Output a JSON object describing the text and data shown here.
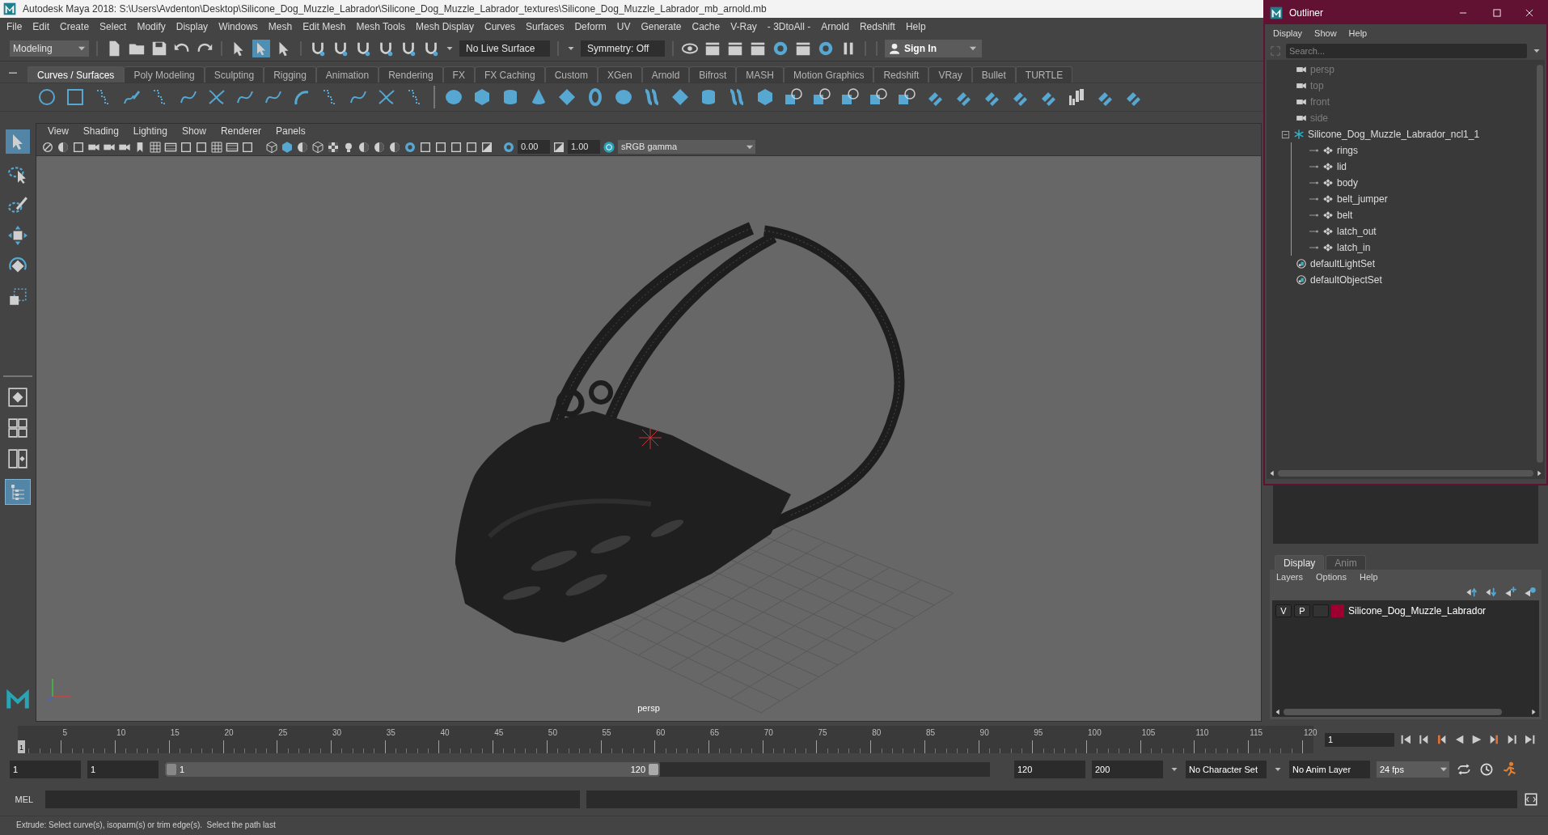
{
  "window": {
    "title": "Autodesk Maya 2018: S:\\Users\\Avdenton\\Desktop\\Silicone_Dog_Muzzle_Labrador\\Silicone_Dog_Muzzle_Labrador_textures\\Silicone_Dog_Muzzle_Labrador_mb_arnold.mb"
  },
  "menu_bar": [
    "File",
    "Edit",
    "Create",
    "Select",
    "Modify",
    "Display",
    "Windows",
    "Mesh",
    "Edit Mesh",
    "Mesh Tools",
    "Mesh Display",
    "Curves",
    "Surfaces",
    "Deform",
    "UV",
    "Generate",
    "Cache",
    "V-Ray",
    "- 3DtoAll -",
    "Arnold",
    "Redshift",
    "Help"
  ],
  "status_line": {
    "workspace": "Modeling",
    "live_surface": "No Live Surface",
    "symmetry": "Symmetry: Off",
    "sign_in": "Sign In"
  },
  "shelf_tabs": [
    {
      "label": "Curves / Surfaces",
      "selected": true
    },
    {
      "label": "Poly Modeling",
      "selected": false
    },
    {
      "label": "Sculpting",
      "selected": false
    },
    {
      "label": "Rigging",
      "selected": false
    },
    {
      "label": "Animation",
      "selected": false
    },
    {
      "label": "Rendering",
      "selected": false
    },
    {
      "label": "FX",
      "selected": false
    },
    {
      "label": "FX Caching",
      "selected": false
    },
    {
      "label": "Custom",
      "selected": false
    },
    {
      "label": "XGen",
      "selected": false
    },
    {
      "label": "Arnold",
      "selected": false
    },
    {
      "label": "Bifrost",
      "selected": false
    },
    {
      "label": "MASH",
      "selected": false
    },
    {
      "label": "Motion Graphics",
      "selected": false
    },
    {
      "label": "Redshift",
      "selected": false
    },
    {
      "label": "VRay",
      "selected": false
    },
    {
      "label": "Bullet",
      "selected": false
    },
    {
      "label": "TURTLE",
      "selected": false
    }
  ],
  "viewport": {
    "menus": [
      "View",
      "Shading",
      "Lighting",
      "Show",
      "Renderer",
      "Panels"
    ],
    "exposure": "0.00",
    "gamma": "1.00",
    "color_space": "sRGB gamma",
    "camera_label": "persp"
  },
  "outliner": {
    "title": "Outliner",
    "menus": [
      "Display",
      "Show",
      "Help"
    ],
    "search": {
      "placeholder": "Search..."
    },
    "items": [
      {
        "label": "persp",
        "kind": "camera"
      },
      {
        "label": "top",
        "kind": "camera"
      },
      {
        "label": "front",
        "kind": "camera"
      },
      {
        "label": "side",
        "kind": "camera"
      },
      {
        "label": "Silicone_Dog_Muzzle_Labrador_ncl1_1",
        "kind": "group",
        "expanded": true,
        "children": [
          {
            "label": "rings",
            "kind": "mesh"
          },
          {
            "label": "lid",
            "kind": "mesh"
          },
          {
            "label": "body",
            "kind": "mesh"
          },
          {
            "label": "belt_jumper",
            "kind": "mesh"
          },
          {
            "label": "belt",
            "kind": "mesh"
          },
          {
            "label": "latch_out",
            "kind": "mesh"
          },
          {
            "label": "latch_in",
            "kind": "mesh"
          }
        ]
      },
      {
        "label": "defaultLightSet",
        "kind": "set"
      },
      {
        "label": "defaultObjectSet",
        "kind": "set"
      }
    ]
  },
  "layer_editor": {
    "tabs": [
      {
        "label": "Display",
        "selected": true
      },
      {
        "label": "Anim",
        "selected": false
      }
    ],
    "menus": [
      "Layers",
      "Options",
      "Help"
    ],
    "layers": [
      {
        "visibility": "V",
        "playback": "P",
        "color": "#9b0030",
        "name": "Silicone_Dog_Muzzle_Labrador"
      }
    ]
  },
  "time_slider": {
    "tick_labels": [
      "5",
      "10",
      "15",
      "20",
      "25",
      "30",
      "35",
      "40",
      "45",
      "50",
      "55",
      "60",
      "65",
      "70",
      "75",
      "80",
      "85",
      "90",
      "95",
      "100",
      "105",
      "110",
      "115",
      "120"
    ],
    "current_frame": "1",
    "frame_field": "1"
  },
  "range_slider": {
    "start_field": "1",
    "playback_start": "1",
    "range_start": "1",
    "range_end": "120",
    "level": 0.6,
    "playback_end": "120",
    "end_field": "200",
    "character_set": "No Character Set",
    "anim_layer": "No Anim Layer",
    "fps": "24 fps"
  },
  "command_line": {
    "label": "MEL"
  },
  "help_line": "Extrude: Select curve(s), isoparm(s) or trim edge(s).  Select the path last"
}
